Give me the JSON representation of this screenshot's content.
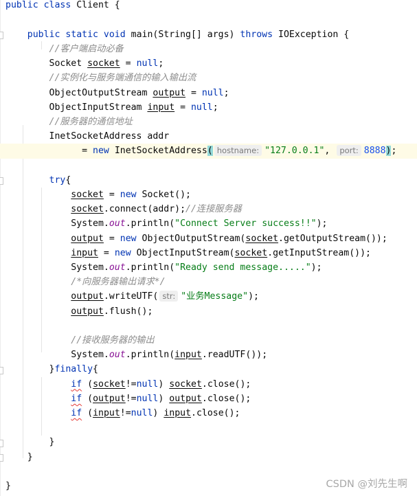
{
  "editor": {
    "language": "java",
    "current_line": 10,
    "colors": {
      "keyword": "#0033b3",
      "comment": "#8c8c8c",
      "string": "#067d17",
      "number": "#1750eb",
      "field": "#871094",
      "current_line_bg": "#fefbe6",
      "brace_match": "#93d9d9",
      "error_underline": "#e53935"
    },
    "lines": [
      [
        {
          "t": "public class ",
          "c": "kw"
        },
        {
          "t": "Client {"
        }
      ],
      [],
      [
        {
          "t": "    "
        },
        {
          "t": "public static void ",
          "c": "kw"
        },
        {
          "t": "main(String[] args) "
        },
        {
          "t": "throws ",
          "c": "kw"
        },
        {
          "t": "IOException {"
        }
      ],
      [
        {
          "t": "        "
        },
        {
          "t": "//客户端启动必备",
          "c": "cm"
        }
      ],
      [
        {
          "t": "        Socket "
        },
        {
          "t": "socket",
          "c": "var"
        },
        {
          "t": " = "
        },
        {
          "t": "null",
          "c": "kw"
        },
        {
          "t": ";"
        }
      ],
      [
        {
          "t": "        "
        },
        {
          "t": "//实例化与服务端通信的输入输出流",
          "c": "cm"
        }
      ],
      [
        {
          "t": "        ObjectOutputStream "
        },
        {
          "t": "output",
          "c": "var"
        },
        {
          "t": " = "
        },
        {
          "t": "null",
          "c": "kw"
        },
        {
          "t": ";"
        }
      ],
      [
        {
          "t": "        ObjectInputStream "
        },
        {
          "t": "input",
          "c": "var"
        },
        {
          "t": " = "
        },
        {
          "t": "null",
          "c": "kw"
        },
        {
          "t": ";"
        }
      ],
      [
        {
          "t": "        "
        },
        {
          "t": "//服务器的通信地址",
          "c": "cm"
        }
      ],
      [
        {
          "t": "        InetSocketAddress addr"
        }
      ],
      [
        {
          "t": "              = "
        },
        {
          "t": "new ",
          "c": "kw"
        },
        {
          "t": "InetSocketAddress"
        },
        {
          "t": "(",
          "c": "brace"
        },
        {
          "t": "hostname:",
          "c": "hint"
        },
        {
          "t": "\"127.0.0.1\"",
          "c": "str"
        },
        {
          "t": ", "
        },
        {
          "t": "port:",
          "c": "hint"
        },
        {
          "t": "8888",
          "c": "num"
        },
        {
          "t": ")",
          "c": "brace"
        },
        {
          "t": ";"
        }
      ],
      [],
      [
        {
          "t": "        "
        },
        {
          "t": "try",
          "c": "kw"
        },
        {
          "t": "{"
        }
      ],
      [
        {
          "t": "            "
        },
        {
          "t": "socket",
          "c": "var"
        },
        {
          "t": " = "
        },
        {
          "t": "new ",
          "c": "kw"
        },
        {
          "t": "Socket();"
        }
      ],
      [
        {
          "t": "            "
        },
        {
          "t": "socket",
          "c": "var"
        },
        {
          "t": ".connect(addr);"
        },
        {
          "t": "//连接服务器",
          "c": "cm"
        }
      ],
      [
        {
          "t": "            System."
        },
        {
          "t": "out",
          "c": "field"
        },
        {
          "t": ".println("
        },
        {
          "t": "\"Connect Server success!!\"",
          "c": "str"
        },
        {
          "t": ");"
        }
      ],
      [
        {
          "t": "            "
        },
        {
          "t": "output",
          "c": "var"
        },
        {
          "t": " = "
        },
        {
          "t": "new ",
          "c": "kw"
        },
        {
          "t": "ObjectOutputStream("
        },
        {
          "t": "socket",
          "c": "var"
        },
        {
          "t": ".getOutputStream());"
        }
      ],
      [
        {
          "t": "            "
        },
        {
          "t": "input",
          "c": "var"
        },
        {
          "t": " = "
        },
        {
          "t": "new ",
          "c": "kw"
        },
        {
          "t": "ObjectInputStream("
        },
        {
          "t": "socket",
          "c": "var"
        },
        {
          "t": ".getInputStream());"
        }
      ],
      [
        {
          "t": "            System."
        },
        {
          "t": "out",
          "c": "field"
        },
        {
          "t": ".println("
        },
        {
          "t": "\"Ready send message.....\"",
          "c": "str"
        },
        {
          "t": ");"
        }
      ],
      [
        {
          "t": "            "
        },
        {
          "t": "/*向服务器输出请求*/",
          "c": "cm"
        }
      ],
      [
        {
          "t": "            "
        },
        {
          "t": "output",
          "c": "var"
        },
        {
          "t": ".writeUTF("
        },
        {
          "t": "str:",
          "c": "hint"
        },
        {
          "t": "\"业务Message\"",
          "c": "str"
        },
        {
          "t": ");"
        }
      ],
      [
        {
          "t": "            "
        },
        {
          "t": "output",
          "c": "var"
        },
        {
          "t": ".flush();"
        }
      ],
      [],
      [
        {
          "t": "            "
        },
        {
          "t": "//接收服务器的输出",
          "c": "cm"
        }
      ],
      [
        {
          "t": "            System."
        },
        {
          "t": "out",
          "c": "field"
        },
        {
          "t": ".println("
        },
        {
          "t": "input",
          "c": "var"
        },
        {
          "t": ".readUTF());"
        }
      ],
      [
        {
          "t": "        }"
        },
        {
          "t": "finally",
          "c": "kw"
        },
        {
          "t": "{"
        }
      ],
      [
        {
          "t": "            "
        },
        {
          "t": "if",
          "c": "kw warn"
        },
        {
          "t": " ("
        },
        {
          "t": "socket",
          "c": "var"
        },
        {
          "t": "!="
        },
        {
          "t": "null",
          "c": "kw"
        },
        {
          "t": ") "
        },
        {
          "t": "socket",
          "c": "var"
        },
        {
          "t": ".close();"
        }
      ],
      [
        {
          "t": "            "
        },
        {
          "t": "if",
          "c": "kw warn"
        },
        {
          "t": " ("
        },
        {
          "t": "output",
          "c": "var"
        },
        {
          "t": "!="
        },
        {
          "t": "null",
          "c": "kw"
        },
        {
          "t": ") "
        },
        {
          "t": "output",
          "c": "var"
        },
        {
          "t": ".close();"
        }
      ],
      [
        {
          "t": "            "
        },
        {
          "t": "if",
          "c": "kw warn"
        },
        {
          "t": " ("
        },
        {
          "t": "input",
          "c": "var"
        },
        {
          "t": "!="
        },
        {
          "t": "null",
          "c": "kw"
        },
        {
          "t": ") "
        },
        {
          "t": "input",
          "c": "var"
        },
        {
          "t": ".close();"
        }
      ],
      [],
      [
        {
          "t": "        }"
        }
      ],
      [
        {
          "t": "    }"
        }
      ],
      [],
      [
        {
          "t": "}"
        }
      ]
    ]
  },
  "watermark": "CSDN @刘先生啊"
}
